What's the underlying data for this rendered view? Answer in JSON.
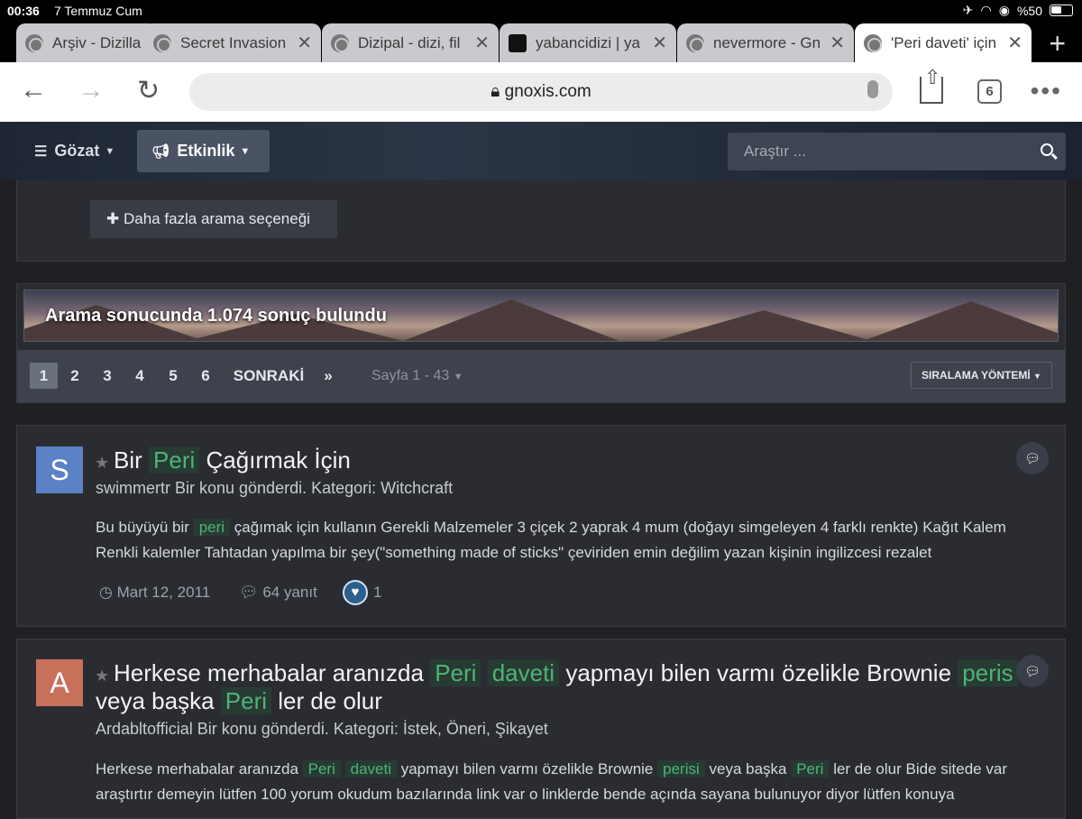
{
  "status_bar": {
    "time": "00:36",
    "date": "7 Temmuz Cum",
    "battery": "%50"
  },
  "tabs": [
    {
      "title": "Arşiv - Dizilla"
    },
    {
      "title": "Secret Invasion"
    },
    {
      "title": "Dizipal - dizi, fil"
    },
    {
      "title": "yabancidizi | ya"
    },
    {
      "title": "nevermore - Gn"
    },
    {
      "title": "'Peri daveti' için"
    }
  ],
  "address_bar": {
    "url": "gnoxis.com",
    "tab_count": "6"
  },
  "site_nav": {
    "browse": "Gözat",
    "activity": "Etkinlik",
    "search_placeholder": "Araştır ..."
  },
  "search_panel": {
    "more_options": "Daha fazla arama seçeneği"
  },
  "results": {
    "summary": "Arama sonucunda 1.074 sonuç bulundu",
    "pages": [
      "1",
      "2",
      "3",
      "4",
      "5",
      "6"
    ],
    "next": "SONRAKİ",
    "last": "»",
    "page_info": "Sayfa 1 - 43",
    "sort": "SIRALAMA YÖNTEMİ"
  },
  "items": [
    {
      "avatar_letter": "S",
      "avatar_color": "#5b82c4",
      "title_parts": [
        "Bir",
        "Peri",
        "Çağırmak İçin"
      ],
      "meta": "swimmertr Bir konu gönderdi. Kategori: Witchcraft",
      "snippet_parts": [
        "Bu büyüyü bir",
        "peri",
        "çağımak için kullanın Gerekli Malzemeler 3 çiçek 2 yaprak 4 mum (doğayı simgeleyen 4 farklı renkte) Kağıt",
        "Kalem Renkli kalemler Tahtadan yapılma bir şey(\"something made of sticks\" çeviriden emin değilim yazan kişinin ingilizcesi rezalet"
      ],
      "date": "Mart 12, 2011",
      "replies": "64 yanıt",
      "likes": "1"
    },
    {
      "avatar_letter": "A",
      "avatar_color": "#c9705a",
      "title_parts": [
        "Herkese merhabalar aranızda",
        "Peri",
        "daveti",
        "yapmayı bilen varmı özelikle Brownie",
        "peris",
        "veya başka",
        "Peri",
        "ler de olur"
      ],
      "meta": "Ardabltofficial Bir konu gönderdi. Kategori: İstek, Öneri, Şikayet",
      "snippet_parts": [
        "Herkese merhabalar aranızda",
        "Peri",
        "daveti",
        "yapmayı bilen varmı özelikle Brownie",
        "perisi",
        "veya başka",
        "Peri",
        "ler de olur Bide sitede",
        "var araştırtır demeyin lütfen 100 yorum okudum bazılarında link var o linklerde bende açında sayana bulunuyor diyor lütfen konuya"
      ]
    }
  ],
  "colors": {
    "highlight_bg": "#273b33",
    "highlight_text": "#4fb377",
    "panel": "#2a2c31"
  }
}
